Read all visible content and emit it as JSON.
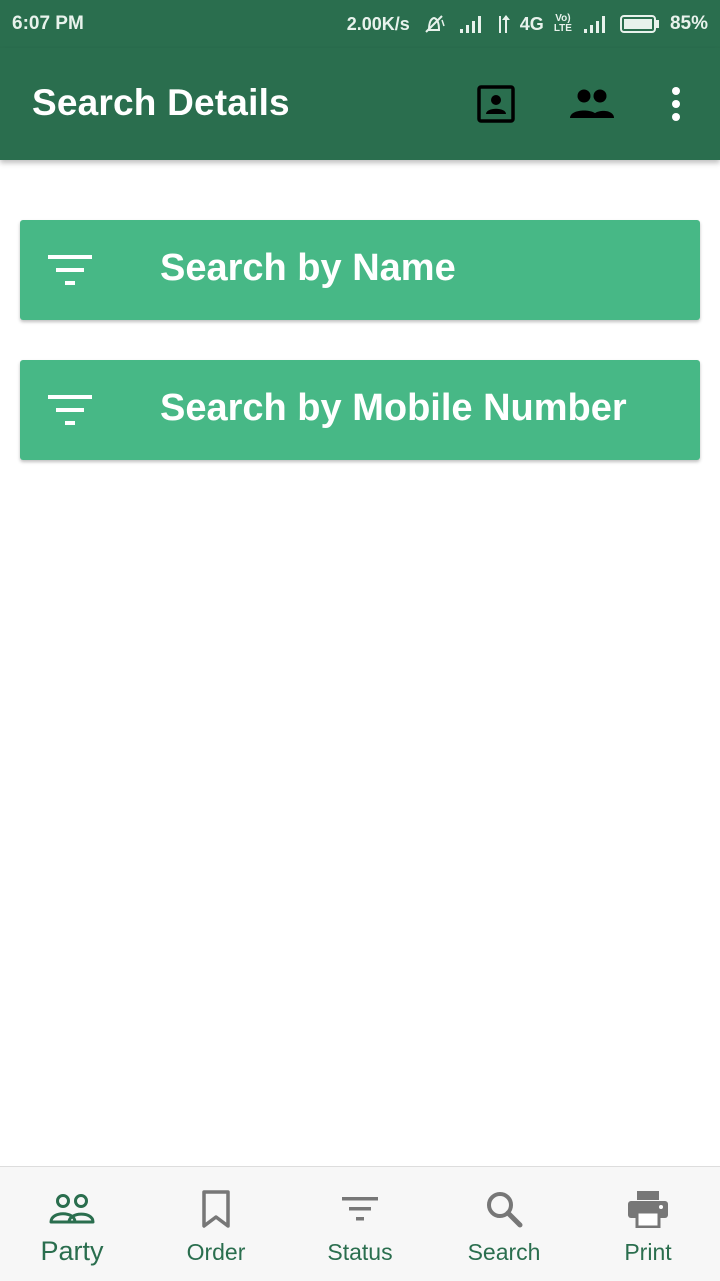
{
  "status_bar": {
    "time": "6:07 PM",
    "net_speed": "2.00K/s",
    "network_type": "4G",
    "volte_top": "Vo)",
    "volte_bottom": "LTE",
    "battery": "85%",
    "icons": [
      "alarm-off-icon",
      "signal-icon",
      "data-arrows-icon",
      "volte-icon",
      "signal-icon",
      "battery-icon"
    ]
  },
  "app_bar": {
    "title": "Search Details",
    "icons": [
      "contact-icon",
      "group-icon",
      "more-vert-icon"
    ]
  },
  "search_options": [
    {
      "label": "Search by Name",
      "icon": "filter-icon"
    },
    {
      "label": "Search by Mobile Number",
      "icon": "filter-icon"
    }
  ],
  "bottom_nav": {
    "active_index": 0,
    "items": [
      {
        "label": "Party",
        "icon": "party-icon"
      },
      {
        "label": "Order",
        "icon": "bookmark-icon"
      },
      {
        "label": "Status",
        "icon": "filter-icon"
      },
      {
        "label": "Search",
        "icon": "search-icon"
      },
      {
        "label": "Print",
        "icon": "print-icon"
      }
    ]
  },
  "colors": {
    "primary": "#2a6e4e",
    "card": "#47b886",
    "nav_inactive_icon": "#777777"
  }
}
